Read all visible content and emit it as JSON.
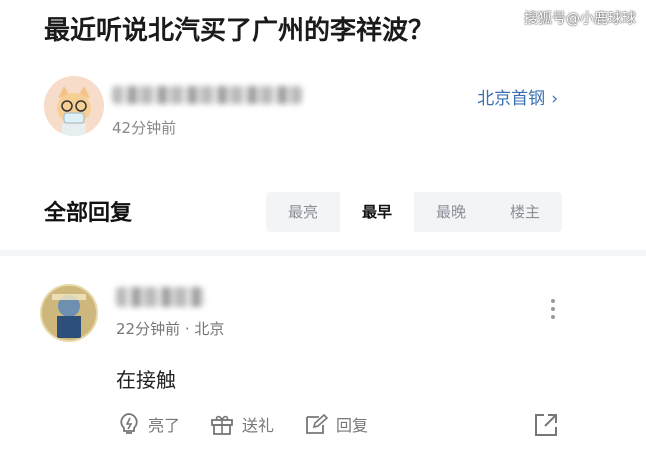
{
  "post": {
    "title": "最近听说北汽买了广州的李祥波？"
  },
  "watermark": "搜狐号@小鹿球球",
  "author": {
    "time": "42分钟前",
    "tag_label": "北京首钢"
  },
  "replies": {
    "section_title": "全部回复",
    "sort_tabs": [
      {
        "label": "最亮",
        "active": false
      },
      {
        "label": "最早",
        "active": true
      },
      {
        "label": "最晚",
        "active": false
      },
      {
        "label": "楼主",
        "active": false
      }
    ]
  },
  "comment": {
    "meta": "22分钟前 · 北京",
    "text": "在接触",
    "actions": {
      "like_label": "亮了",
      "gift_label": "送礼",
      "reply_label": "回复"
    }
  },
  "colors": {
    "link": "#3a6fb0",
    "tab_bg": "#f3f4f6",
    "muted": "#888888"
  }
}
